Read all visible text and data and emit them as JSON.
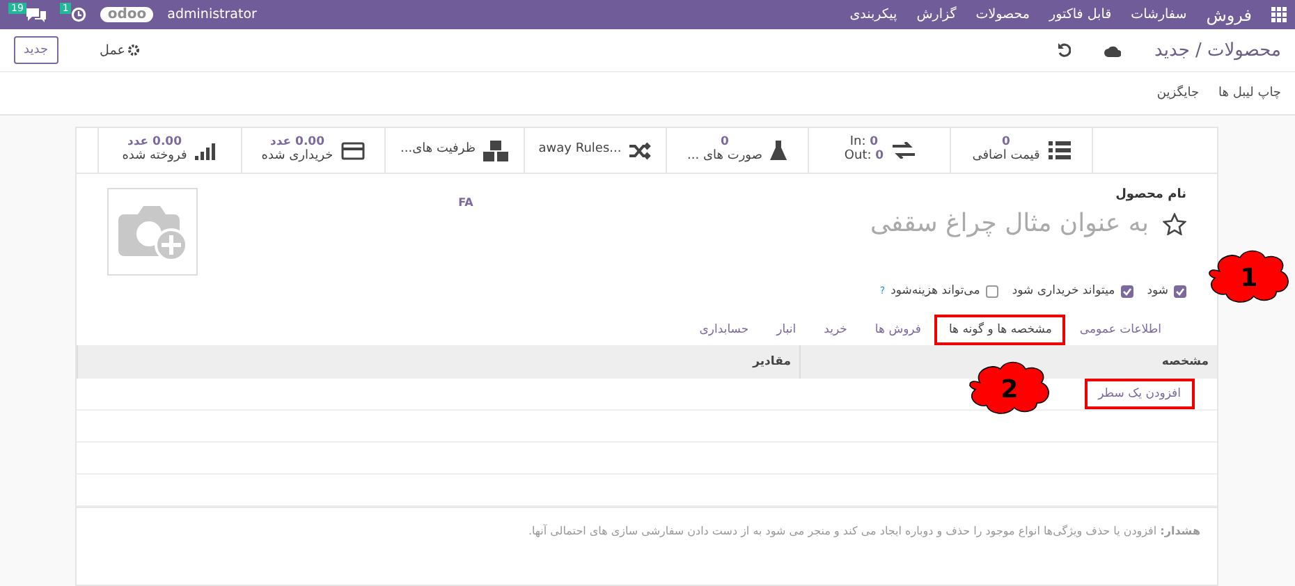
{
  "topbar": {
    "app": "فروش",
    "menu": [
      "سفارشات",
      "قابل فاکتور",
      "محصولات",
      "گزارش",
      "پیکربندی"
    ],
    "user": "administrator",
    "logo": "odoo",
    "activity_count": "1",
    "message_count": "19"
  },
  "control": {
    "breadcrumb": "محصولات / جدید",
    "new_button": "جدید",
    "action_button": "عمل",
    "links": [
      "چاپ لیبل ها",
      "جایگزین"
    ]
  },
  "stats": [
    {
      "kind": "empty"
    },
    {
      "kind": "list",
      "value": "0",
      "label": "قیمت اضافی"
    },
    {
      "kind": "inout",
      "in_label": "In:",
      "in_value": "0",
      "out_label": "Out:",
      "out_value": "0"
    },
    {
      "kind": "flask",
      "value": "0",
      "label": "صورت های ..."
    },
    {
      "kind": "shuffle",
      "label": "...away Rules"
    },
    {
      "kind": "cubes",
      "label": "ظرفیت های..."
    },
    {
      "kind": "card",
      "value": "0.00",
      "unit": "عدد",
      "label": "خریداری شده"
    },
    {
      "kind": "bars",
      "value": "0.00",
      "unit": "عدد",
      "label": "فروخته شده"
    }
  ],
  "form": {
    "name_label": "نام محصول",
    "name_placeholder": "به عنوان مثال چراغ سقفی",
    "favorite": false,
    "lang": "FA",
    "options": [
      {
        "label": "شود",
        "checked": true
      },
      {
        "label": "میتواند خریداری شود",
        "checked": true
      },
      {
        "label": "می‌تواند هزینه‌شود",
        "checked": false,
        "help": "?"
      }
    ],
    "tabs": [
      {
        "label": "اطلاعات عمومی",
        "selected": false
      },
      {
        "label": "مشخصه ها و گونه ها",
        "selected": true
      },
      {
        "label": "فروش ها",
        "selected": false
      },
      {
        "label": "خرید",
        "selected": false
      },
      {
        "label": "انبار",
        "selected": false
      },
      {
        "label": "حسابداری",
        "selected": false
      }
    ],
    "table": {
      "columns": [
        "مشخصه",
        "مقادیر"
      ],
      "add_line": "افزودن یک سطر"
    },
    "warning": "**هشدار:** افزودن یا حذف ویژگی‌ها انواع موجود را حذف و دوباره ایجاد می کند و منجر می شود به از دست دادن سفارشی سازی های احتمالی آنها."
  },
  "callouts": [
    {
      "label": "1"
    },
    {
      "label": "2"
    }
  ]
}
